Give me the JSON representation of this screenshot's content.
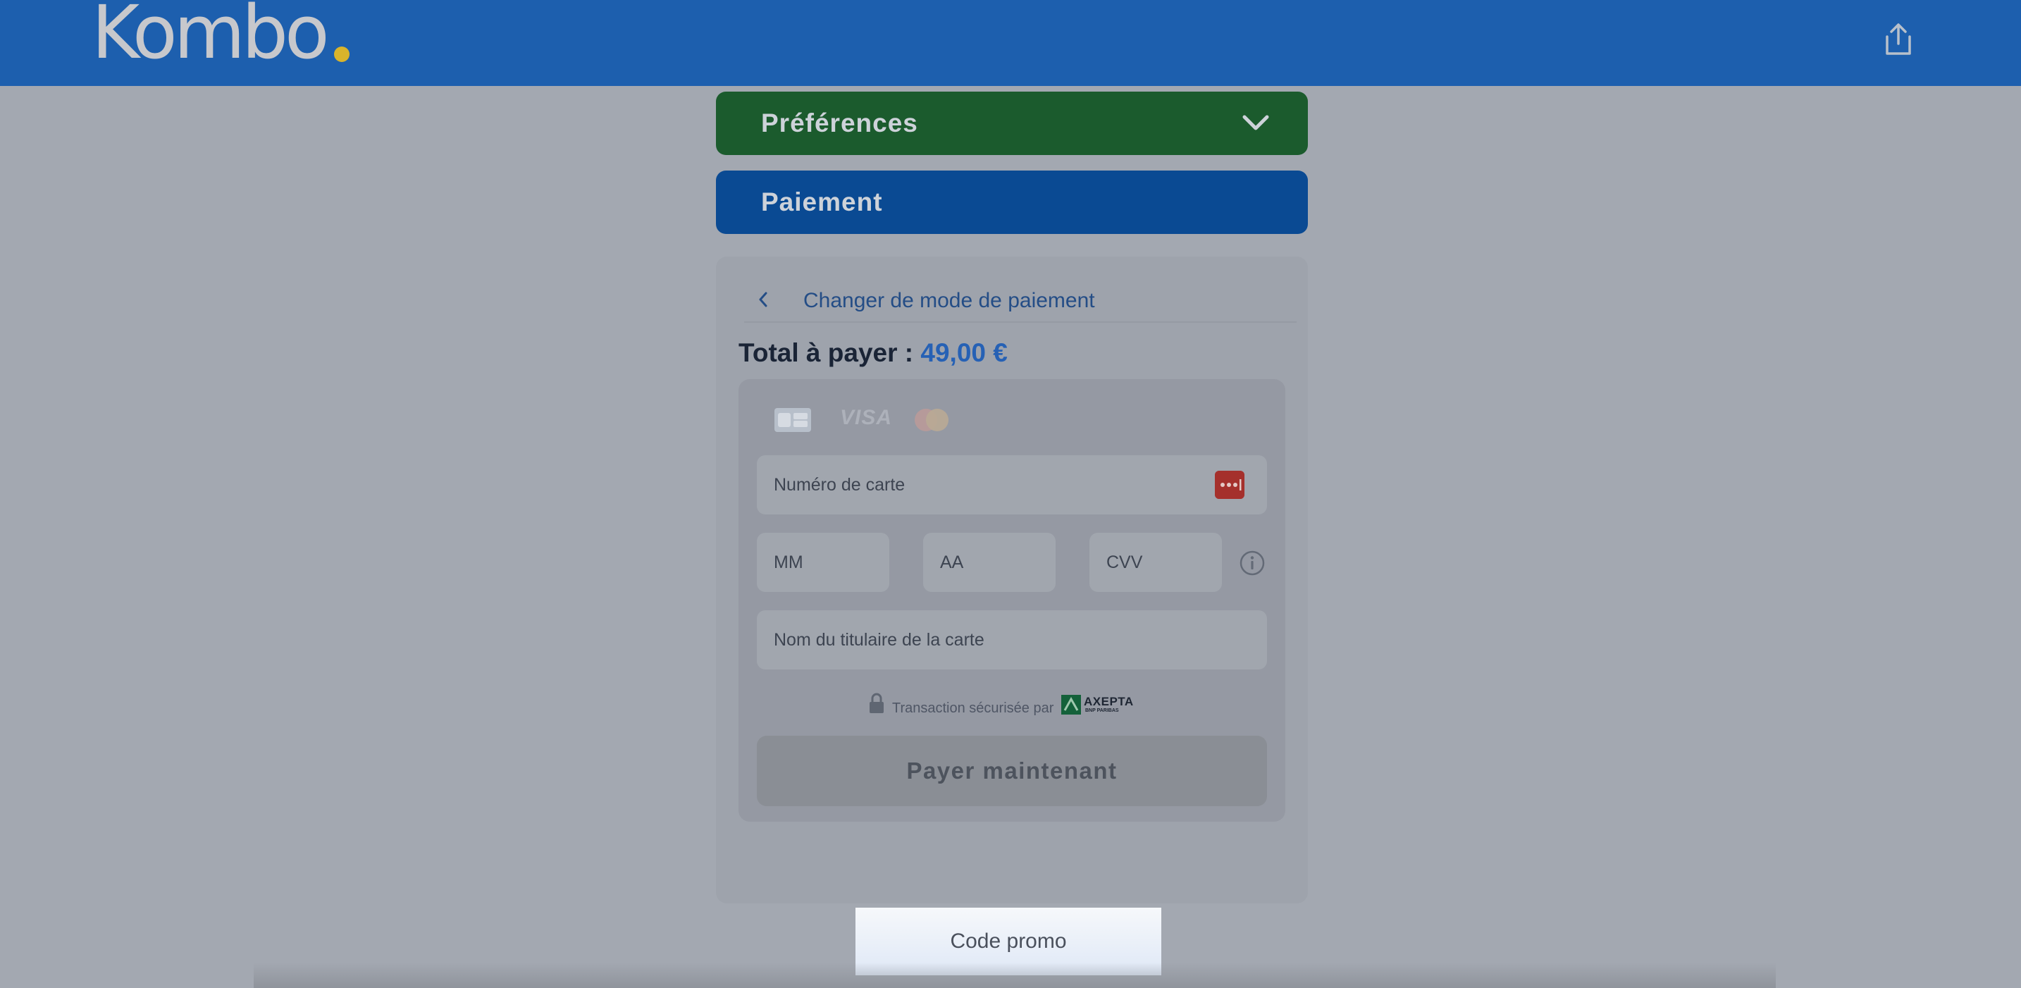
{
  "header": {
    "logo_text": "Kombo",
    "logo_dot_color": "#d9b42b",
    "bar_color": "#1d5fae",
    "share_icon": "share-icon"
  },
  "sections": {
    "preferences_label": "Préférences",
    "preferences_color": "#1b5b2d",
    "payment_label": "Paiement",
    "payment_color": "#0a4a93"
  },
  "payment": {
    "back_label": "Changer de mode de paiement",
    "total_label": "Total à payer :",
    "total_amount": "49,00 €",
    "brands": [
      "cb-logo",
      "VISA",
      "mastercard-logo"
    ],
    "card_number_placeholder": "Numéro de carte",
    "month_placeholder": "MM",
    "year_placeholder": "AA",
    "cvv_placeholder": "CVV",
    "holder_placeholder": "Nom du titulaire de la carte",
    "secure_label": "Transaction sécurisée par",
    "provider_name": "AXEPTA",
    "provider_sub": "BNP PARIBAS",
    "pay_button_label": "Payer maintenant"
  },
  "promo": {
    "label": "Code promo"
  }
}
